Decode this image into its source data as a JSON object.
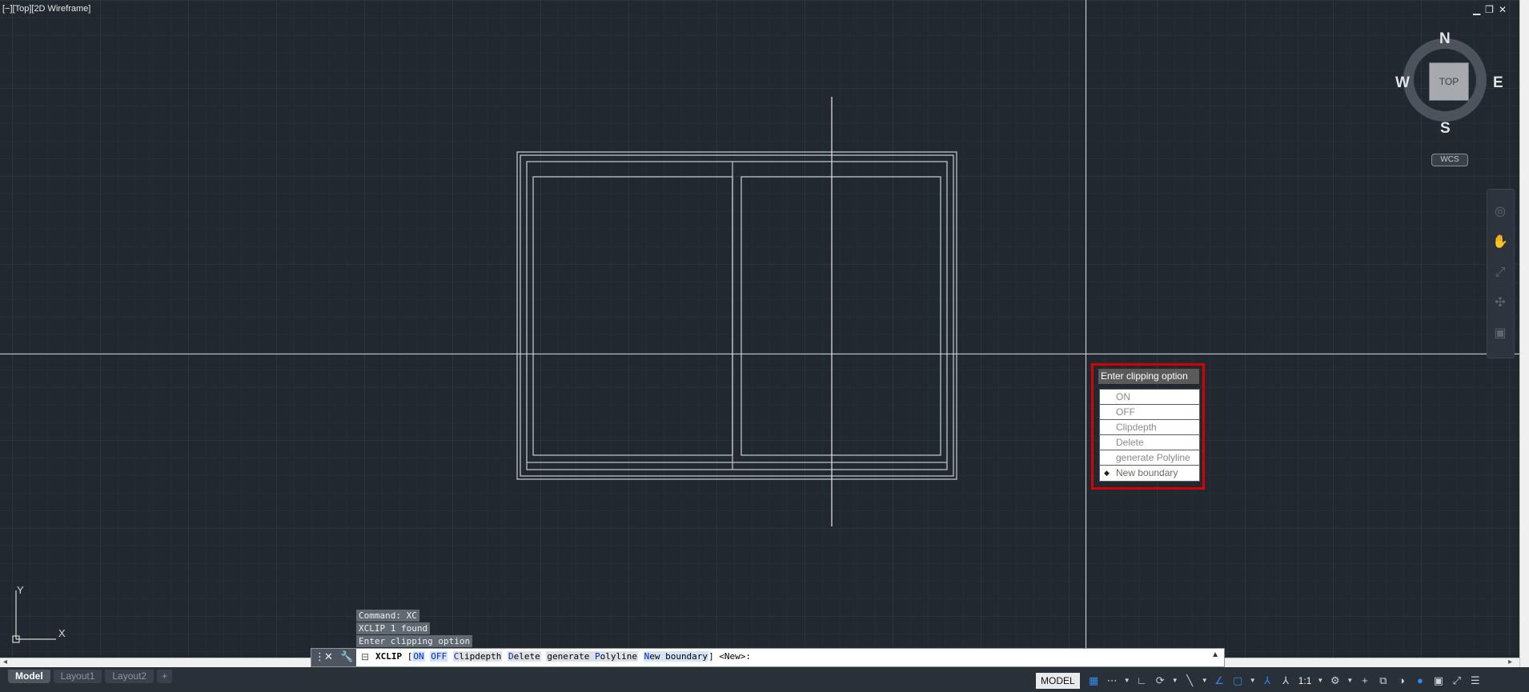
{
  "viewport": {
    "label": "[−][Top][2D Wireframe]",
    "window_controls": [
      "▁",
      "❐",
      "✕"
    ]
  },
  "viewcube": {
    "north": "N",
    "south": "S",
    "east": "E",
    "west": "W",
    "face": "TOP",
    "ucs_badge": "WCS"
  },
  "navbar": {
    "icons": [
      "steering-wheel-icon",
      "pan-icon",
      "zoom-icon",
      "orbit-icon",
      "showmotion-icon"
    ]
  },
  "clip_menu": {
    "title": "Enter clipping option",
    "options": [
      {
        "label": "ON",
        "selected": false
      },
      {
        "label": "OFF",
        "selected": false
      },
      {
        "label": "Clipdepth",
        "selected": false
      },
      {
        "label": "Delete",
        "selected": false
      },
      {
        "label": "generate Polyline",
        "selected": false
      },
      {
        "label": "New boundary",
        "selected": true
      }
    ],
    "bullet": "◆"
  },
  "ucs": {
    "x": "X",
    "y": "Y"
  },
  "command_history": [
    "Command: XC",
    "XCLIP 1 found",
    "Enter clipping option"
  ],
  "command_line": {
    "command": "XCLIP",
    "open_bracket": "[",
    "close_bracket": "]",
    "opt_on_key": "ON",
    "opt_off_key": "OFF",
    "opt_clipdepth_key": "C",
    "opt_clipdepth_rest": "lipdepth",
    "opt_delete_key": "D",
    "opt_delete_rest": "elete",
    "opt_genpoly_pre": "generate ",
    "opt_genpoly_key": "P",
    "opt_genpoly_rest": "olyline",
    "opt_newb_key": "N",
    "opt_newb_rest": "ew boundary",
    "default": "<New>:"
  },
  "tabs": [
    "Model",
    "Layout1",
    "Layout2",
    "+"
  ],
  "status": {
    "model": "MODEL",
    "scale": "1:1"
  },
  "colors": {
    "background": "#212830",
    "highlight_border": "#d60000",
    "accent": "#2e8cf0"
  }
}
